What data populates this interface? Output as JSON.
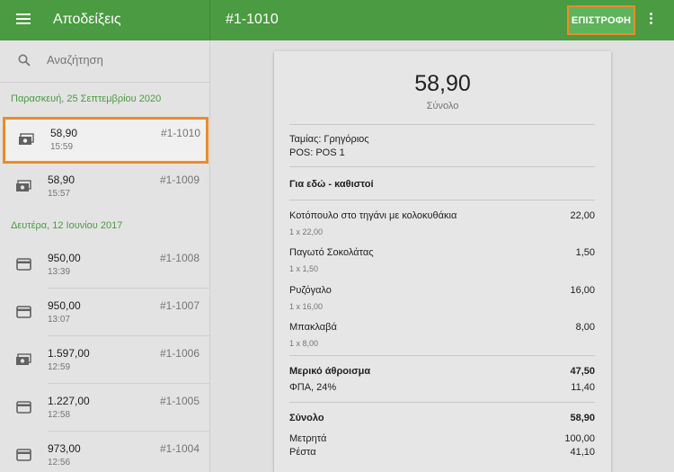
{
  "topbar": {
    "app_title": "Αποδείξεις",
    "receipt_id": "#1-1010",
    "refund_label": "ΕΠΙΣΤΡΟΦΗ"
  },
  "sidebar": {
    "search_placeholder": "Αναζήτηση",
    "groups": [
      {
        "date": "Παρασκευή, 25 Σεπτεμβρίου 2020"
      },
      {
        "date": "Δευτέρα, 12 Ιουνίου 2017"
      }
    ],
    "receipts": [
      {
        "amount": "58,90",
        "time": "15:59",
        "number": "#1-1010",
        "icon": "cash-icon",
        "selected": true
      },
      {
        "amount": "58,90",
        "time": "15:57",
        "number": "#1-1009",
        "icon": "cash-icon"
      },
      {
        "amount": "950,00",
        "time": "13:39",
        "number": "#1-1008",
        "icon": "card-icon"
      },
      {
        "amount": "950,00",
        "time": "13:07",
        "number": "#1-1007",
        "icon": "card-icon"
      },
      {
        "amount": "1.597,00",
        "time": "12:59",
        "number": "#1-1006",
        "icon": "cash-icon"
      },
      {
        "amount": "1.227,00",
        "time": "12:58",
        "number": "#1-1005",
        "icon": "card-icon"
      },
      {
        "amount": "973,00",
        "time": "12:56",
        "number": "#1-1004",
        "icon": "card-icon"
      }
    ]
  },
  "receipt": {
    "total": "58,90",
    "total_label": "Σύνολο",
    "cashier": "Ταμίας: Γρηγόριος",
    "pos": "POS: POS 1",
    "dining": "Για εδώ - καθιστοί",
    "items": [
      {
        "name": "Κοτόπουλο στο τηγάνι με κολοκυθάκια",
        "price": "22,00",
        "qty": "1 x 22,00"
      },
      {
        "name": "Παγωτό Σοκολάτας",
        "price": "1,50",
        "qty": "1 x 1,50"
      },
      {
        "name": "Ρυζόγαλο",
        "price": "16,00",
        "qty": "1 x 16,00"
      },
      {
        "name": "Μπακλαβά",
        "price": "8,00",
        "qty": "1 x 8,00"
      }
    ],
    "subtotal_label": "Μερικό άθροισμα",
    "subtotal": "47,50",
    "tax_label": "ΦΠΑ, 24%",
    "tax": "11,40",
    "grand_label": "Σύνολο",
    "grand": "58,90",
    "cash_label": "Μετρητά",
    "cash": "100,00",
    "change_label": "Ρέστα",
    "change": "41,10"
  },
  "colors": {
    "topbar": "#4a9b41",
    "accent_green": "#4a9b41",
    "highlight": "#f08a24"
  }
}
